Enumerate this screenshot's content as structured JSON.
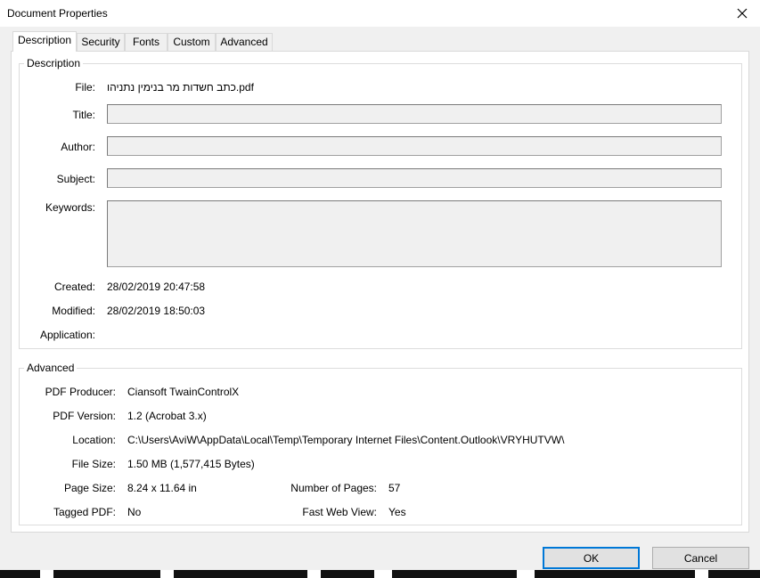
{
  "window": {
    "title": "Document Properties"
  },
  "tabs": [
    "Description",
    "Security",
    "Fonts",
    "Custom",
    "Advanced"
  ],
  "description": {
    "legend": "Description",
    "file_label": "File:",
    "file_value": "כתב חשדות מר בנימין נתניהו.pdf",
    "title_label": "Title:",
    "title_value": "",
    "author_label": "Author:",
    "author_value": "",
    "subject_label": "Subject:",
    "subject_value": "",
    "keywords_label": "Keywords:",
    "keywords_value": "",
    "created_label": "Created:",
    "created_value": "28/02/2019 20:47:58",
    "modified_label": "Modified:",
    "modified_value": "28/02/2019 18:50:03",
    "application_label": "Application:",
    "application_value": ""
  },
  "advanced": {
    "legend": "Advanced",
    "producer_label": "PDF Producer:",
    "producer_value": "Ciansoft TwainControlX",
    "version_label": "PDF Version:",
    "version_value": "1.2 (Acrobat 3.x)",
    "location_label": "Location:",
    "location_value": "C:\\Users\\AviW\\AppData\\Local\\Temp\\Temporary Internet Files\\Content.Outlook\\VRYHUTVW\\",
    "filesize_label": "File Size:",
    "filesize_value": "1.50 MB (1,577,415 Bytes)",
    "pagesize_label": "Page Size:",
    "pagesize_value": "8.24 x 11.64 in",
    "numpages_label": "Number of Pages:",
    "numpages_value": "57",
    "tagged_label": "Tagged PDF:",
    "tagged_value": "No",
    "fastweb_label": "Fast Web View:",
    "fastweb_value": "Yes"
  },
  "buttons": {
    "ok": "OK",
    "cancel": "Cancel"
  }
}
